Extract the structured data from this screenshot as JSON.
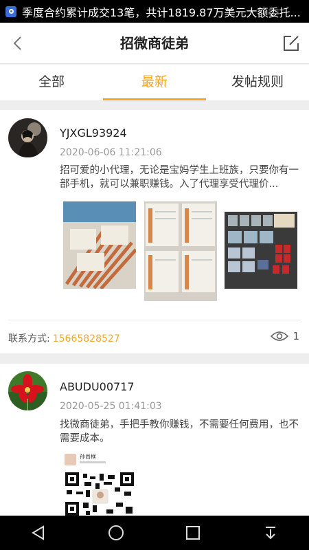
{
  "status_bar": {
    "ticker_text": "季度合约累计成交13笔，共计1819.87万美元大额委托..."
  },
  "header": {
    "title": "招微商徒弟"
  },
  "tabs": [
    {
      "label": "全部",
      "active": false
    },
    {
      "label": "最新",
      "active": true
    },
    {
      "label": "发帖规则",
      "active": false
    }
  ],
  "posts": [
    {
      "username": "YJXGL93924",
      "time": "2020-06-06 11:21:06",
      "body": "招可爱的小代理，无论是宝妈学生上班族，只要你有一部手机，就可以兼职赚钱。入了代理享受代理价...",
      "contact_label": "联系方式:",
      "contact_phone": "15665828527",
      "views": "1"
    },
    {
      "username": "ABUDU00717",
      "time": "2020-05-25 01:41:03",
      "body": "找微商徒弟，手把手教你赚钱，不需要任何费用，也不需要成本。",
      "qr_label": "孙尚框"
    }
  ],
  "colors": {
    "accent": "#f5a623",
    "bars": "#000000"
  },
  "icons": {
    "back": "chevron-left-icon",
    "edit": "edit-icon",
    "views": "eye-icon",
    "nav_back": "triangle-back-icon",
    "nav_home": "circle-home-icon",
    "nav_recent": "square-recent-icon",
    "nav_notification": "pull-down-icon"
  }
}
